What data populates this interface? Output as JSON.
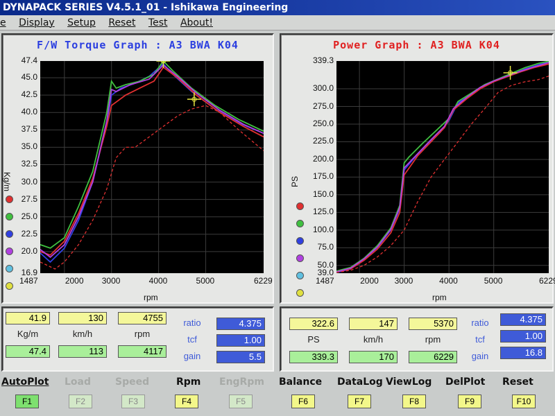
{
  "window": {
    "title": "DYNAPACK SERIES V4.5.1_01  - Ishikawa Engineering"
  },
  "menu": {
    "items": [
      "e",
      "Display",
      "Setup",
      "Reset",
      "Test",
      "About!"
    ]
  },
  "torque_panel": {
    "title": "F/W Torque Graph : A3 BWA K04",
    "title_color": "#2a3ee0",
    "ylabel": "Kg/m",
    "xlabel": "rpm",
    "yticks": [
      "47.4",
      "45.0",
      "42.5",
      "40.0",
      "37.5",
      "35.0",
      "32.5",
      "30.0",
      "27.5",
      "25.0",
      "22.5",
      "20.0",
      "16.9"
    ],
    "xticks": [
      "1487",
      "2000",
      "3000",
      "4000",
      "5000",
      "6229"
    ],
    "readout": {
      "row1": [
        "41.9",
        "130",
        "4755"
      ],
      "labels": [
        "Kg/m",
        "km/h",
        "rpm"
      ],
      "row2": [
        "47.4",
        "113",
        "4117"
      ],
      "ratio_label": "ratio",
      "ratio": "4.375",
      "tcf_label": "tcf",
      "tcf": "1.00",
      "gain_label": "gain",
      "gain": "5.5"
    }
  },
  "power_panel": {
    "title": "Power Graph : A3 BWA K04",
    "title_color": "#e02020",
    "ylabel": "PS",
    "xlabel": "rpm",
    "yticks": [
      "339.3",
      "300.0",
      "275.0",
      "250.0",
      "225.0",
      "200.0",
      "175.0",
      "150.0",
      "125.0",
      "100.0",
      "75.0",
      "50.0",
      "39.0"
    ],
    "xticks": [
      "1487",
      "2000",
      "3000",
      "4000",
      "5000",
      "6229"
    ],
    "readout": {
      "row1": [
        "322.6",
        "147",
        "5370"
      ],
      "labels": [
        "PS",
        "km/h",
        "rpm"
      ],
      "row2": [
        "339.3",
        "170",
        "6229"
      ],
      "ratio_label": "ratio",
      "ratio": "4.375",
      "tcf_label": "tcf",
      "tcf": "1.00",
      "gain_label": "gain",
      "gain": "16.8"
    }
  },
  "legend_colors": [
    "#e03030",
    "#40c040",
    "#3040e0",
    "#b040e0",
    "#60c0e0",
    "#e0e040"
  ],
  "function_keys": [
    {
      "label": "AutoPlot",
      "key": "F1",
      "state": "active"
    },
    {
      "label": "Load",
      "key": "F2",
      "state": "dim"
    },
    {
      "label": "Speed",
      "key": "F3",
      "state": "dim"
    },
    {
      "label": "Rpm",
      "key": "F4",
      "state": "on"
    },
    {
      "label": "EngRpm",
      "key": "F5",
      "state": "dim"
    },
    {
      "label": "Balance",
      "key": "F6",
      "state": "on"
    },
    {
      "label": "DataLog",
      "key": "F7",
      "state": "on"
    },
    {
      "label": "ViewLog",
      "key": "F8",
      "state": "on"
    },
    {
      "label": "DelPlot",
      "key": "F9",
      "state": "on"
    },
    {
      "label": "Reset",
      "key": "F10",
      "state": "on"
    }
  ],
  "chart_data": [
    {
      "type": "line",
      "title": "F/W Torque Graph : A3 BWA K04",
      "xlabel": "rpm",
      "ylabel": "Kg/m",
      "xlim": [
        1487,
        6229
      ],
      "ylim": [
        16.9,
        47.4
      ],
      "grid": true,
      "series": [
        {
          "color": "#3040e0",
          "x": [
            1487,
            1700,
            2000,
            2300,
            2600,
            2900,
            3000,
            3200,
            3500,
            3800,
            4100,
            4300,
            4700,
            5200,
            5700,
            6229
          ],
          "y": [
            19.8,
            18.5,
            20.5,
            24.5,
            30.0,
            38.5,
            42.5,
            43.5,
            44.2,
            45.2,
            47.0,
            45.5,
            43.0,
            40.5,
            38.5,
            37.0
          ]
        },
        {
          "color": "#40c040",
          "x": [
            1487,
            1700,
            2000,
            2300,
            2600,
            2900,
            3000,
            3100,
            3300,
            3600,
            3900,
            4100,
            4300,
            4700,
            5200,
            5700,
            6229
          ],
          "y": [
            21.0,
            20.5,
            22.0,
            26.5,
            31.5,
            40.0,
            44.5,
            43.5,
            44.0,
            44.5,
            45.5,
            47.4,
            46.0,
            43.5,
            41.0,
            39.0,
            37.3
          ]
        },
        {
          "color": "#e03030",
          "x": [
            1487,
            1700,
            2000,
            2300,
            2600,
            2900,
            3000,
            3300,
            3600,
            3900,
            4100,
            4400,
            4800,
            5300,
            5800,
            6229
          ],
          "y": [
            20.0,
            19.5,
            21.5,
            25.5,
            30.5,
            38.0,
            41.0,
            42.5,
            43.5,
            44.5,
            46.5,
            45.0,
            42.5,
            40.0,
            38.0,
            36.5
          ]
        },
        {
          "color": "#b040e0",
          "x": [
            1487,
            1700,
            2000,
            2300,
            2600,
            2900,
            3000,
            3100,
            3400,
            3800,
            4100,
            4400,
            4800,
            5300,
            5800,
            6229
          ],
          "y": [
            20.3,
            19.2,
            21.0,
            25.0,
            30.0,
            38.8,
            43.3,
            43.0,
            44.0,
            44.8,
            46.8,
            45.2,
            42.8,
            40.3,
            38.3,
            37.0
          ]
        },
        {
          "color": "#e03030",
          "dashed": true,
          "x": [
            1487,
            1800,
            2000,
            2300,
            2600,
            2900,
            3100,
            3300,
            3500,
            3800,
            4100,
            4400,
            4700,
            5000,
            5300,
            5700,
            6229
          ],
          "y": [
            18.5,
            17.5,
            18.5,
            21.0,
            24.5,
            29.0,
            33.5,
            35.0,
            35.0,
            36.5,
            38.0,
            39.5,
            40.5,
            41.0,
            40.0,
            37.5,
            34.5
          ]
        }
      ]
    },
    {
      "type": "line",
      "title": "Power Graph : A3 BWA K04",
      "xlabel": "rpm",
      "ylabel": "PS",
      "xlim": [
        1487,
        6229
      ],
      "ylim": [
        39.0,
        339.3
      ],
      "grid": true,
      "series": [
        {
          "color": "#3040e0",
          "x": [
            1487,
            1800,
            2100,
            2400,
            2700,
            2900,
            3000,
            3200,
            3500,
            3800,
            4000,
            4200,
            4500,
            4800,
            5100,
            5400,
            5700,
            6000,
            6229
          ],
          "y": [
            40,
            45,
            58,
            75,
            100,
            130,
            185,
            200,
            220,
            238,
            255,
            280,
            292,
            305,
            313,
            320,
            328,
            334,
            338
          ]
        },
        {
          "color": "#40c040",
          "x": [
            1487,
            1800,
            2100,
            2400,
            2700,
            2900,
            3000,
            3100,
            3400,
            3700,
            4000,
            4200,
            4500,
            4800,
            5100,
            5400,
            5700,
            6000,
            6229
          ],
          "y": [
            42,
            47,
            60,
            78,
            103,
            135,
            195,
            203,
            222,
            240,
            258,
            282,
            294,
            306,
            314,
            322,
            330,
            336,
            339
          ]
        },
        {
          "color": "#e03030",
          "x": [
            1487,
            1800,
            2100,
            2400,
            2700,
            2900,
            3000,
            3300,
            3600,
            3900,
            4100,
            4400,
            4700,
            5000,
            5300,
            5600,
            5900,
            6229
          ],
          "y": [
            41,
            45,
            57,
            73,
            96,
            125,
            178,
            205,
            225,
            245,
            270,
            286,
            300,
            310,
            317,
            324,
            330,
            335
          ]
        },
        {
          "color": "#b040e0",
          "x": [
            1487,
            1800,
            2100,
            2400,
            2700,
            2900,
            3000,
            3300,
            3600,
            3900,
            4100,
            4400,
            4700,
            5000,
            5300,
            5600,
            5900,
            6229
          ],
          "y": [
            41,
            46,
            59,
            76,
            101,
            132,
            188,
            208,
            228,
            247,
            272,
            288,
            302,
            311,
            318,
            325,
            331,
            337
          ]
        },
        {
          "color": "#e03030",
          "dashed": true,
          "x": [
            1487,
            1800,
            2100,
            2400,
            2700,
            3000,
            3300,
            3600,
            3900,
            4200,
            4500,
            4800,
            5100,
            5400,
            5700,
            6000,
            6229
          ],
          "y": [
            40,
            43,
            50,
            62,
            78,
            100,
            140,
            175,
            200,
            225,
            250,
            272,
            295,
            305,
            310,
            313,
            318
          ]
        }
      ]
    }
  ]
}
